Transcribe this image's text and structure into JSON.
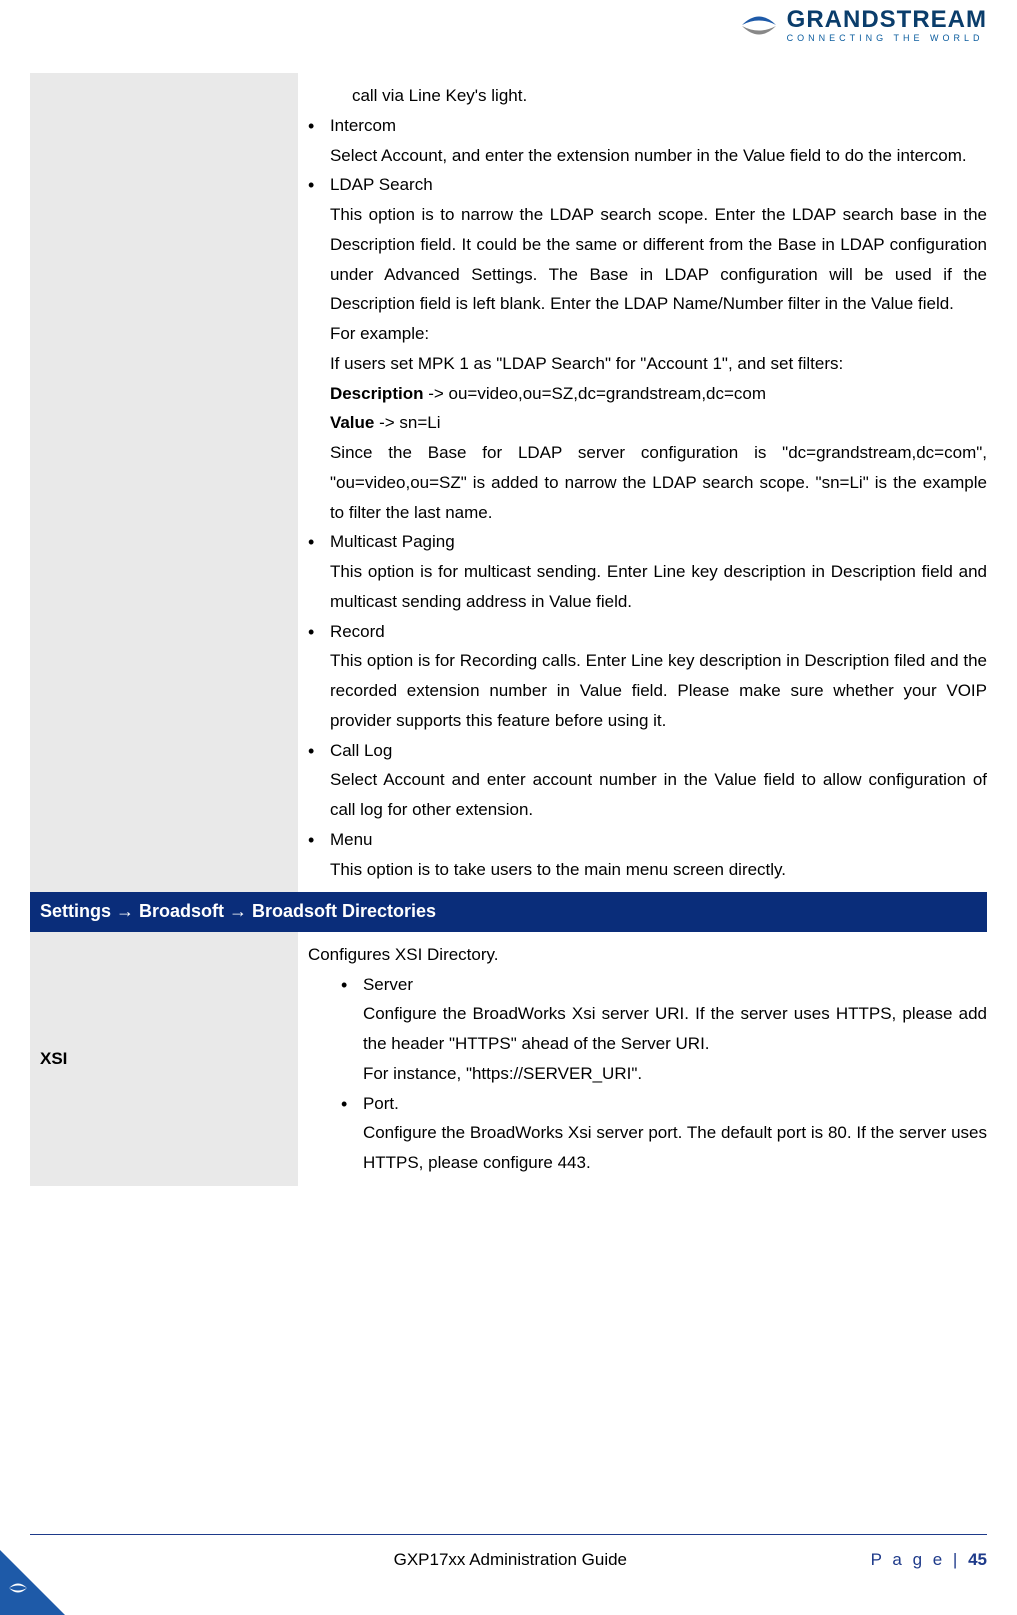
{
  "header": {
    "brand": "GRANDSTREAM",
    "tagline": "CONNECTING THE WORLD"
  },
  "row1": {
    "intro": "call via Line Key's light.",
    "items": [
      {
        "title": "Intercom",
        "desc": "Select Account, and enter the extension number in the Value field to do the intercom."
      },
      {
        "title": "LDAP Search",
        "desc": "This option is to narrow the LDAP search scope. Enter the LDAP search base in the Description field. It could be the same or different from the Base in LDAP configuration under Advanced Settings. The Base in LDAP configuration will be used if the Description field is left blank. Enter the LDAP Name/Number filter in the Value field.",
        "extra1": "For example:",
        "extra2": "If users set MPK 1 as \"LDAP Search\" for \"Account 1\", and set filters:",
        "extra3a": "Description",
        "extra3b": " -> ou=video,ou=SZ,dc=grandstream,dc=com",
        "extra4a": "Value",
        "extra4b": " -> sn=Li",
        "extra5": "Since the Base for LDAP server configuration is \"dc=grandstream,dc=com\", \"ou=video,ou=SZ\" is added to narrow the LDAP search scope. \"sn=Li\" is the example to filter the last name."
      },
      {
        "title": "Multicast Paging",
        "desc": "This option is for multicast sending. Enter Line key description in Description field and multicast sending address in Value field."
      },
      {
        "title": "Record",
        "desc": "This option is for Recording calls. Enter Line key description in Description filed and the recorded extension number in Value field. Please make sure whether your VOIP provider supports this feature before using it."
      },
      {
        "title": "Call Log",
        "desc": "Select Account and enter account number in the Value field to allow configuration of call log for other extension."
      },
      {
        "title": "Menu",
        "desc": "This option is to take users to the main menu screen directly."
      }
    ]
  },
  "sectionHeader": "Settings → Broadsoft → Broadsoft Directories",
  "row2": {
    "label": "XSI",
    "intro": "Configures XSI Directory.",
    "items": [
      {
        "title": "Server",
        "desc": "Configure the BroadWorks Xsi server URI. If the server uses HTTPS, please add the header \"HTTPS\" ahead of the Server URI.",
        "extra": "For instance, \"https://SERVER_URI\"."
      },
      {
        "title": "Port.",
        "desc": "Configure the BroadWorks Xsi server port. The default port is 80. If the server uses HTTPS, please configure 443."
      }
    ]
  },
  "footer": {
    "title": "GXP17xx Administration Guide",
    "pageLabel": "P a g e  | ",
    "pageNum": "45"
  }
}
